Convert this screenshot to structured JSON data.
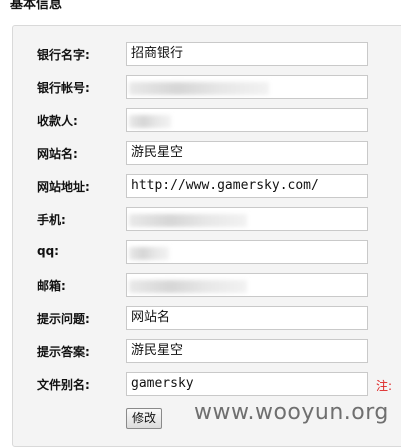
{
  "section_title": "基本信息",
  "form": {
    "rows": [
      {
        "label": "银行名字:",
        "value": "招商银行",
        "redacted": false
      },
      {
        "label": "银行帐号:",
        "value": "",
        "redacted": true
      },
      {
        "label": "收款人:",
        "value": "",
        "redacted": true
      },
      {
        "label": "网站名:",
        "value": "游民星空",
        "redacted": false
      },
      {
        "label": "网站地址:",
        "value": "http://www.gamersky.com/",
        "redacted": false
      },
      {
        "label": "手机:",
        "value": "",
        "redacted": true
      },
      {
        "label": "qq:",
        "value": "",
        "redacted": true
      },
      {
        "label": "邮箱:",
        "value": "",
        "redacted": true
      },
      {
        "label": "提示问题:",
        "value": "网站名",
        "redacted": false
      },
      {
        "label": "提示答案:",
        "value": "游民星空",
        "redacted": false
      },
      {
        "label": "文件别名:",
        "value": "gamersky",
        "redacted": false
      }
    ],
    "alias_note": "注:",
    "submit_label": "修改"
  },
  "watermark": "www.wooyun.org"
}
